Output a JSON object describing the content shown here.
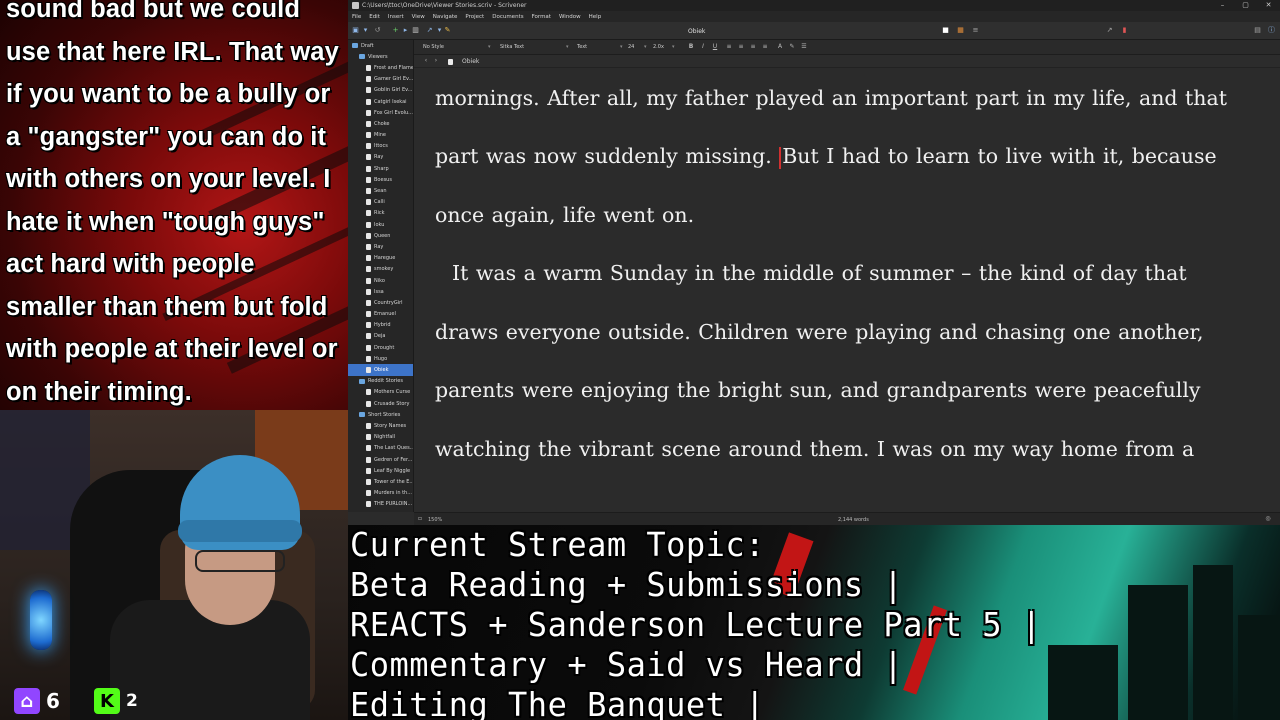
{
  "chat_overlay": {
    "lines": [
      "sound bad but we could",
      "use that here IRL. That way",
      "if you want to be a bully or",
      "a \"gangster\" you can do it",
      "with others on your level. I",
      "hate it when \"tough guys\"",
      "act hard with people",
      "smaller than them but fold",
      "with people at their level or",
      "on their timing."
    ]
  },
  "webcam": {
    "twitch_count": "6",
    "kick_label": "K",
    "kick_count": "2",
    "twitch_color": "#9146ff",
    "kick_color": "#53fc18"
  },
  "app": {
    "title": "C:\\Users\\ttoc\\OneDrive\\Viewer Stories.scriv - Scrivener",
    "window_controls": [
      "–",
      "▢",
      "✕"
    ],
    "menu": [
      "File",
      "Edit",
      "Insert",
      "View",
      "Navigate",
      "Project",
      "Documents",
      "Format",
      "Window",
      "Help"
    ],
    "document_title": "Obiek",
    "format_bar": {
      "style": "No Style",
      "font": "Sitka Text",
      "face": "Text",
      "size": "24",
      "line_spacing": "2.0x"
    },
    "header_document": "Obiek",
    "binder": [
      {
        "label": "Draft",
        "type": "folder",
        "indent": 0
      },
      {
        "label": "Viewers",
        "type": "folder",
        "indent": 1
      },
      {
        "label": "Frost and Flame",
        "type": "doc",
        "indent": 2
      },
      {
        "label": "Gamer Girl Ev...",
        "type": "doc",
        "indent": 2
      },
      {
        "label": "Goblin Girl Ev...",
        "type": "doc",
        "indent": 2
      },
      {
        "label": "Catgirl Isekai",
        "type": "doc",
        "indent": 2
      },
      {
        "label": "Fox Girl Evolu...",
        "type": "doc",
        "indent": 2
      },
      {
        "label": "Choke",
        "type": "doc",
        "indent": 2
      },
      {
        "label": "Mine",
        "type": "doc",
        "indent": 2
      },
      {
        "label": "Ittocs",
        "type": "doc",
        "indent": 2
      },
      {
        "label": "Ray",
        "type": "doc",
        "indent": 2
      },
      {
        "label": "Sharp",
        "type": "doc",
        "indent": 2
      },
      {
        "label": "Boesus",
        "type": "doc",
        "indent": 2
      },
      {
        "label": "Sean",
        "type": "doc",
        "indent": 2
      },
      {
        "label": "Calli",
        "type": "doc",
        "indent": 2
      },
      {
        "label": "Rick",
        "type": "doc",
        "indent": 2
      },
      {
        "label": "Ioku",
        "type": "doc",
        "indent": 2
      },
      {
        "label": "Queen",
        "type": "doc",
        "indent": 2
      },
      {
        "label": "Ray",
        "type": "doc",
        "indent": 2
      },
      {
        "label": "Haregue",
        "type": "doc",
        "indent": 2
      },
      {
        "label": "smokey",
        "type": "doc",
        "indent": 2
      },
      {
        "label": "Niko",
        "type": "doc",
        "indent": 2
      },
      {
        "label": "Issa",
        "type": "doc",
        "indent": 2
      },
      {
        "label": "CountryGirl",
        "type": "doc",
        "indent": 2
      },
      {
        "label": "Emanuel",
        "type": "doc",
        "indent": 2
      },
      {
        "label": "Hybrid",
        "type": "doc",
        "indent": 2
      },
      {
        "label": "Deja",
        "type": "doc",
        "indent": 2
      },
      {
        "label": "Drought",
        "type": "doc",
        "indent": 2
      },
      {
        "label": "Hugo",
        "type": "doc",
        "indent": 2
      },
      {
        "label": "Obiek",
        "type": "doc",
        "indent": 2,
        "selected": true
      },
      {
        "label": "Reddit Stories",
        "type": "folder",
        "indent": 1
      },
      {
        "label": "Mothers Curse",
        "type": "doc",
        "indent": 2
      },
      {
        "label": "Crusade Story",
        "type": "doc",
        "indent": 2
      },
      {
        "label": "Short Stories",
        "type": "folder",
        "indent": 1
      },
      {
        "label": "Story Names",
        "type": "doc",
        "indent": 2
      },
      {
        "label": "Nightfall",
        "type": "doc",
        "indent": 2
      },
      {
        "label": "The Last Ques...",
        "type": "doc",
        "indent": 2
      },
      {
        "label": "Gedren of Fer...",
        "type": "doc",
        "indent": 2
      },
      {
        "label": "Leaf By Niggle",
        "type": "doc",
        "indent": 2
      },
      {
        "label": "Tower of the E...",
        "type": "doc",
        "indent": 2
      },
      {
        "label": "Murders in th...",
        "type": "doc",
        "indent": 2
      },
      {
        "label": "THE PURLOIN...",
        "type": "doc",
        "indent": 2
      }
    ],
    "editor_paragraphs": [
      {
        "before_cursor": "mornings. After all, my father played an important part in my life, and that part was now suddenly missing. ",
        "after_cursor": "But I had to learn to live with it, because once again, life went on."
      },
      {
        "before_cursor": "",
        "after_cursor": "It was a warm Sunday in the middle of summer – the kind of day that draws everyone outside. Children were playing and chasing one another, parents were enjoying the bright sun, and grandparents were peacefully watching the vibrant scene around them. I was on my way home from a"
      }
    ],
    "status": {
      "zoom": "150%",
      "word_count": "2,144 words"
    }
  },
  "stream_topic": {
    "lines": [
      "Current Stream Topic:",
      "Beta Reading + Submissions |",
      "REACTS + Sanderson Lecture Part 5 |",
      "Commentary + Said vs Heard |",
      "Editing The Banquet |"
    ]
  }
}
